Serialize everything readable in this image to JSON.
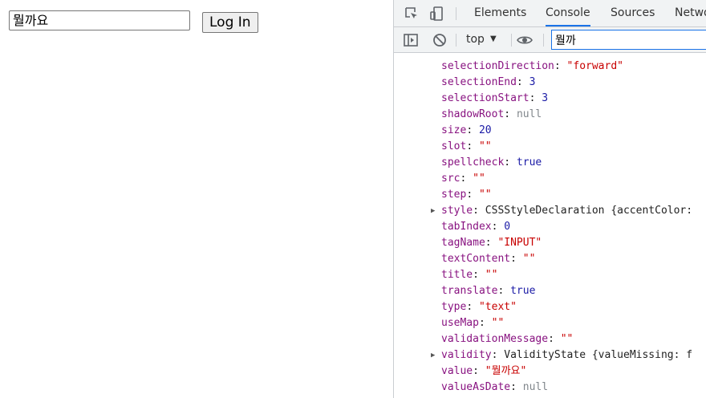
{
  "page": {
    "input_value": "뭘까요",
    "button_label": "Log In"
  },
  "devtools": {
    "tabs": [
      "Elements",
      "Console",
      "Sources",
      "Netwo"
    ],
    "active_tab": "Console",
    "context": "top",
    "filter_value": "뭘까"
  },
  "console": {
    "rows": [
      {
        "key": "selectionDirection",
        "value": "\"forward\"",
        "type": "string",
        "expandable": false
      },
      {
        "key": "selectionEnd",
        "value": "3",
        "type": "number",
        "expandable": false
      },
      {
        "key": "selectionStart",
        "value": "3",
        "type": "number",
        "expandable": false
      },
      {
        "key": "shadowRoot",
        "value": "null",
        "type": "null",
        "expandable": false
      },
      {
        "key": "size",
        "value": "20",
        "type": "number",
        "expandable": false
      },
      {
        "key": "slot",
        "value": "\"\"",
        "type": "string",
        "expandable": false
      },
      {
        "key": "spellcheck",
        "value": "true",
        "type": "number",
        "expandable": false
      },
      {
        "key": "src",
        "value": "\"\"",
        "type": "string",
        "expandable": false
      },
      {
        "key": "step",
        "value": "\"\"",
        "type": "string",
        "expandable": false
      },
      {
        "key": "style",
        "value": "CSSStyleDeclaration {accentColor: ",
        "type": "object",
        "expandable": true
      },
      {
        "key": "tabIndex",
        "value": "0",
        "type": "number",
        "expandable": false
      },
      {
        "key": "tagName",
        "value": "\"INPUT\"",
        "type": "string",
        "expandable": false
      },
      {
        "key": "textContent",
        "value": "\"\"",
        "type": "string",
        "expandable": false
      },
      {
        "key": "title",
        "value": "\"\"",
        "type": "string",
        "expandable": false
      },
      {
        "key": "translate",
        "value": "true",
        "type": "number",
        "expandable": false
      },
      {
        "key": "type",
        "value": "\"text\"",
        "type": "string",
        "expandable": false
      },
      {
        "key": "useMap",
        "value": "\"\"",
        "type": "string",
        "expandable": false
      },
      {
        "key": "validationMessage",
        "value": "\"\"",
        "type": "string",
        "expandable": false
      },
      {
        "key": "validity",
        "value": "ValidityState {valueMissing: f",
        "type": "object",
        "expandable": true
      },
      {
        "key": "value",
        "value": "\"뭘까요\"",
        "type": "string",
        "expandable": false
      },
      {
        "key": "valueAsDate",
        "value": "null",
        "type": "null",
        "expandable": false
      }
    ]
  },
  "icons": [
    "inspect-icon",
    "device-toggle-icon",
    "sidebar-icon",
    "clear-console-icon",
    "eye-icon"
  ],
  "colors": {
    "accent": "#1a73e8",
    "key": "#881280",
    "string": "#c80000",
    "number": "#1a1aa6",
    "null": "#80868b"
  }
}
